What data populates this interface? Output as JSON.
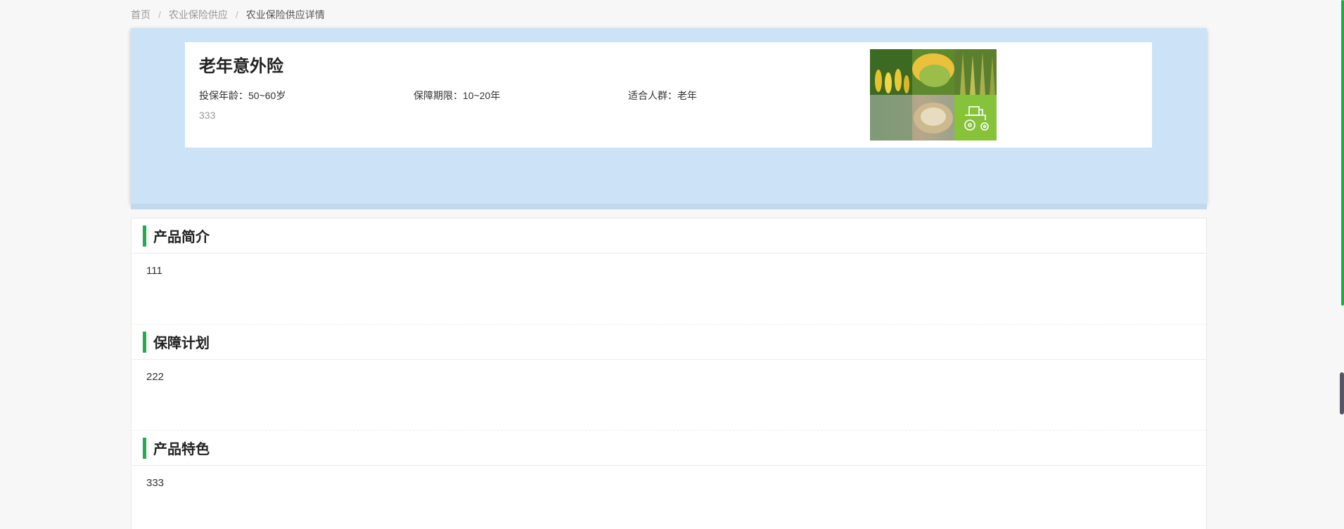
{
  "breadcrumb": {
    "items": [
      "首页",
      "农业保险供应",
      "农业保险供应详情"
    ],
    "separator": "/"
  },
  "product": {
    "title": "老年意外险",
    "age_label": "投保年龄：",
    "age_value": "50~60岁",
    "term_label": "保障期限：",
    "term_value": "10~20年",
    "audience_label": "适合人群：",
    "audience_value": "老年",
    "note": "333"
  },
  "sections": [
    {
      "title": "产品简介",
      "content": "111"
    },
    {
      "title": "保障计划",
      "content": "222"
    },
    {
      "title": "产品特色",
      "content": "333"
    }
  ],
  "colors": {
    "accent": "#1fae4b",
    "hero_bg": "#cce2f7"
  },
  "icons": {
    "tractor": "tractor-icon"
  }
}
